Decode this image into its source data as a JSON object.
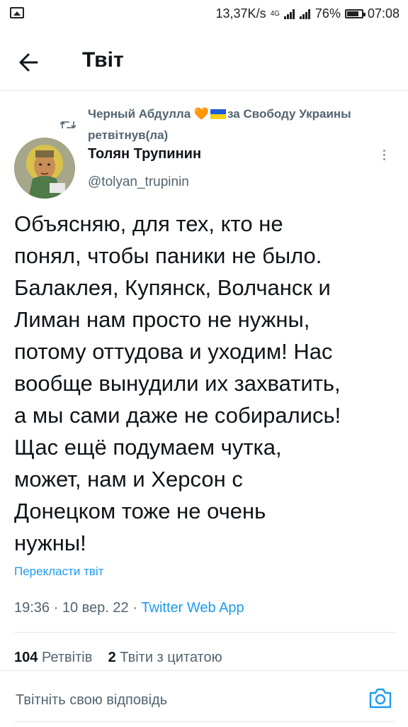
{
  "status_bar": {
    "network_speed": "13,37K/s",
    "network_type": "4G",
    "battery": "76%",
    "time": "07:08"
  },
  "header": {
    "title": "Твіт",
    "back_icon": "arrow-left-icon"
  },
  "retweet": {
    "icon": "retweet-icon",
    "retweeter_name": "Черный Абдулла",
    "retweeter_suffix": "за Свободу Украины",
    "retweeted_label": "ретвітнув(ла)",
    "heart_glyph": "🧡",
    "flag_colors": [
      "#1e5bd8",
      "#f7d117"
    ]
  },
  "tweet": {
    "author_name": "Толян Трупинин",
    "author_handle": "@tolyan_trupinin",
    "more_icon": "more-vertical-icon",
    "text": "Объясняю, для тех, кто не\nпонял, чтобы паники не было.\nБалаклея, Купянск, Волчанск и\nЛиман нам просто не нужны,\nпотому оттудова и уходим! Нас\nвообще вынудили их захватить,\nа мы сами даже не собирались!\nЩас ещё подумаем чутка,\nможет, нам и Херсон с\nДонецком тоже не очень\nнужны!",
    "translate_label": "Перекласти твіт",
    "timestamp": "19:36 · 10 вер. 22 · ",
    "source": "Twitter Web App"
  },
  "stats": {
    "retweets_count": "104",
    "retweets_label": "Ретвітів",
    "quotes_count": "2",
    "quotes_label": "Твіти з цитатою"
  },
  "reply": {
    "placeholder": "Твітніть свою відповідь",
    "camera_icon": "camera-icon"
  },
  "colors": {
    "accent": "#1d9bf0",
    "secondary_text": "#536471",
    "primary_text": "#0f1419"
  }
}
